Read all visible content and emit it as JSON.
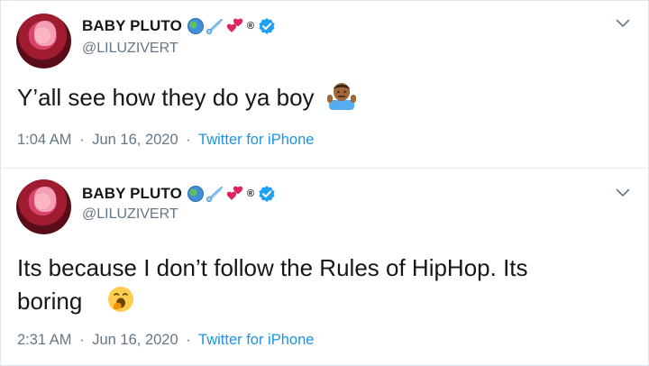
{
  "tweets": [
    {
      "author_name": "BABY PLUTO",
      "name_emojis": [
        "globe-icon",
        "comet-icon",
        "hearts-icon"
      ],
      "registered_mark": "®",
      "verified": true,
      "handle": "@LILUZIVERT",
      "text": "Y’all see how they do ya boy",
      "text_emoji": "person-shrugging-emoji",
      "time": "1:04 AM",
      "date": "Jun 16, 2020",
      "separator": "·",
      "source": "Twitter for iPhone"
    },
    {
      "author_name": "BABY PLUTO",
      "name_emojis": [
        "globe-icon",
        "comet-icon",
        "hearts-icon"
      ],
      "registered_mark": "®",
      "verified": true,
      "handle": "@LILUZIVERT",
      "text_line1": "Its because I  don’t follow the Rules  of HipHop. Its",
      "text_line2": "boring",
      "text_emoji": "yawning-face-emoji",
      "time": "2:31 AM",
      "date": "Jun 16, 2020",
      "separator": "·",
      "source": "Twitter for iPhone"
    }
  ],
  "colors": {
    "text": "#14171a",
    "secondary": "#657786",
    "accent": "#1b95e0",
    "verified": "#1da1f2",
    "border": "#e6ecf0"
  }
}
